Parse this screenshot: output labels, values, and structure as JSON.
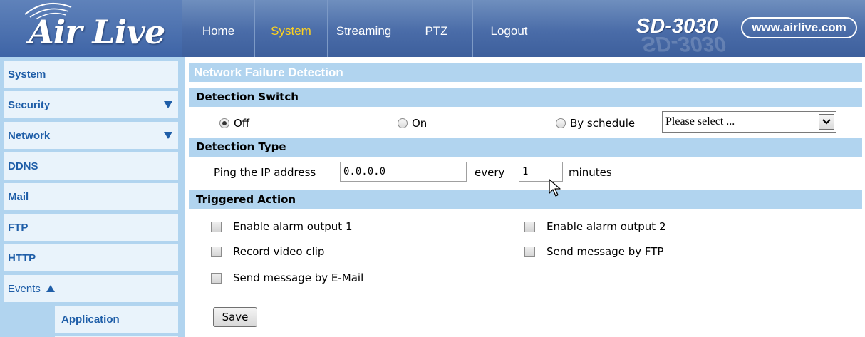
{
  "header": {
    "logo_text": "Air Live",
    "nav": [
      {
        "label": "Home",
        "active": false
      },
      {
        "label": "System",
        "active": true
      },
      {
        "label": "Streaming",
        "active": false
      },
      {
        "label": "PTZ",
        "active": false
      },
      {
        "label": "Logout",
        "active": false
      }
    ],
    "model": "SD-3030",
    "url": "www.airlive.com"
  },
  "sidebar": {
    "items": [
      {
        "label": "System"
      },
      {
        "label": "Security",
        "icon": "dropdown-arrow-icon"
      },
      {
        "label": "Network",
        "icon": "dropdown-arrow-icon"
      },
      {
        "label": "DDNS"
      },
      {
        "label": "Mail"
      },
      {
        "label": "FTP"
      },
      {
        "label": "HTTP"
      },
      {
        "label": "Events",
        "icon": "collapse-arrow-icon"
      }
    ],
    "sub_items": [
      {
        "label": "Application"
      }
    ]
  },
  "main": {
    "page_title": "Network Failure Detection",
    "detection_switch": {
      "title": "Detection Switch",
      "options": [
        {
          "label": "Off",
          "checked": true
        },
        {
          "label": "On",
          "checked": false
        },
        {
          "label": "By schedule",
          "checked": false
        }
      ],
      "schedule_select": "Please select ..."
    },
    "detection_type": {
      "title": "Detection Type",
      "ping_label": "Ping the IP address",
      "ip_value": "0.0.0.0",
      "every_label": "every",
      "interval_value": "1",
      "minutes_label": "minutes"
    },
    "triggered_action": {
      "title": "Triggered Action",
      "options": [
        {
          "label": "Enable alarm output 1",
          "checked": false
        },
        {
          "label": "Enable alarm output 2",
          "checked": false
        },
        {
          "label": "Record video clip",
          "checked": false
        },
        {
          "label": "Send message by FTP",
          "checked": false
        },
        {
          "label": "Send message by E-Mail",
          "checked": false
        }
      ]
    },
    "save_label": "Save"
  },
  "colors": {
    "header_blue": "#4a6ca8",
    "nav_active": "#ffd21e",
    "sidebar_bg": "#b1d4ef",
    "sidebar_item": "#e9f3fb",
    "link_blue": "#1f5ea8"
  }
}
